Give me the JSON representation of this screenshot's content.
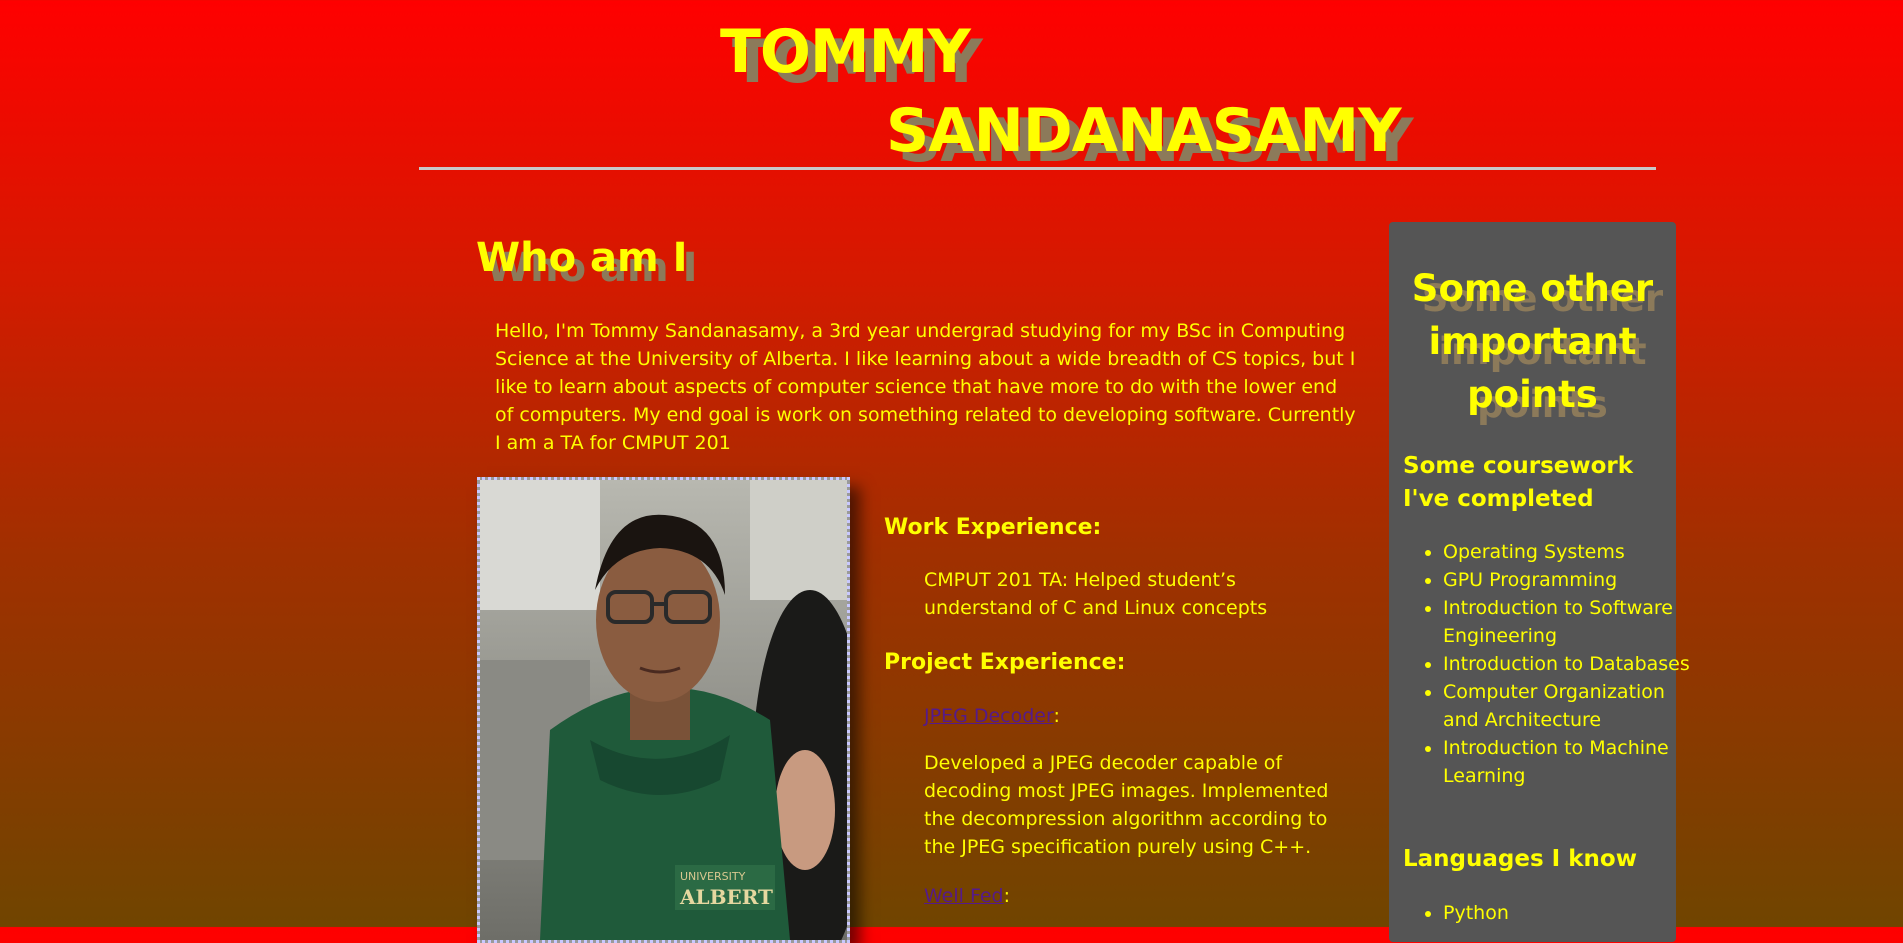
{
  "header": {
    "first_name": "TOMMY",
    "last_name": "SANDANASAMY"
  },
  "about": {
    "heading": "Who am I",
    "intro": "Hello, I'm Tommy Sandanasamy, a 3rd year undergrad studying for my BSc in Computing Science at the University of Alberta. I like learning about a wide breadth of CS topics, but I like to learn about aspects of computer science that have more to do with the lower end of computers. My end goal is work on something related to developing software. Currently I am a TA for CMPUT 201"
  },
  "experience": {
    "work_heading": "Work Experience:",
    "work_text": "CMPUT 201 TA: Helped student’s understand of C and Linux concepts",
    "project_heading": "Project Experience:",
    "projects": [
      {
        "name": "JPEG Decoder",
        "suffix": ":",
        "description": "Developed a JPEG decoder capable of decoding most JPEG images. Implemented the decompression algorithm according to the JPEG specification purely using C++."
      },
      {
        "name": "Well Fed",
        "suffix": ":"
      }
    ]
  },
  "sidebar": {
    "title": "Some other important points",
    "coursework_heading": "Some coursework I've completed",
    "coursework": [
      "Operating Systems",
      "GPU Programming",
      "Introduction to Software Engineering",
      "Introduction to Databases",
      "Computer Organization and Architecture",
      "Introduction to Machine Learning"
    ],
    "languages_heading": "Languages I know",
    "languages": [
      "Python"
    ]
  },
  "colors": {
    "text": "#ffff00",
    "link": "#551a8b",
    "sidebar_bg": "#555555",
    "gradient_top": "#ff0000",
    "gradient_bottom": "#704500"
  }
}
